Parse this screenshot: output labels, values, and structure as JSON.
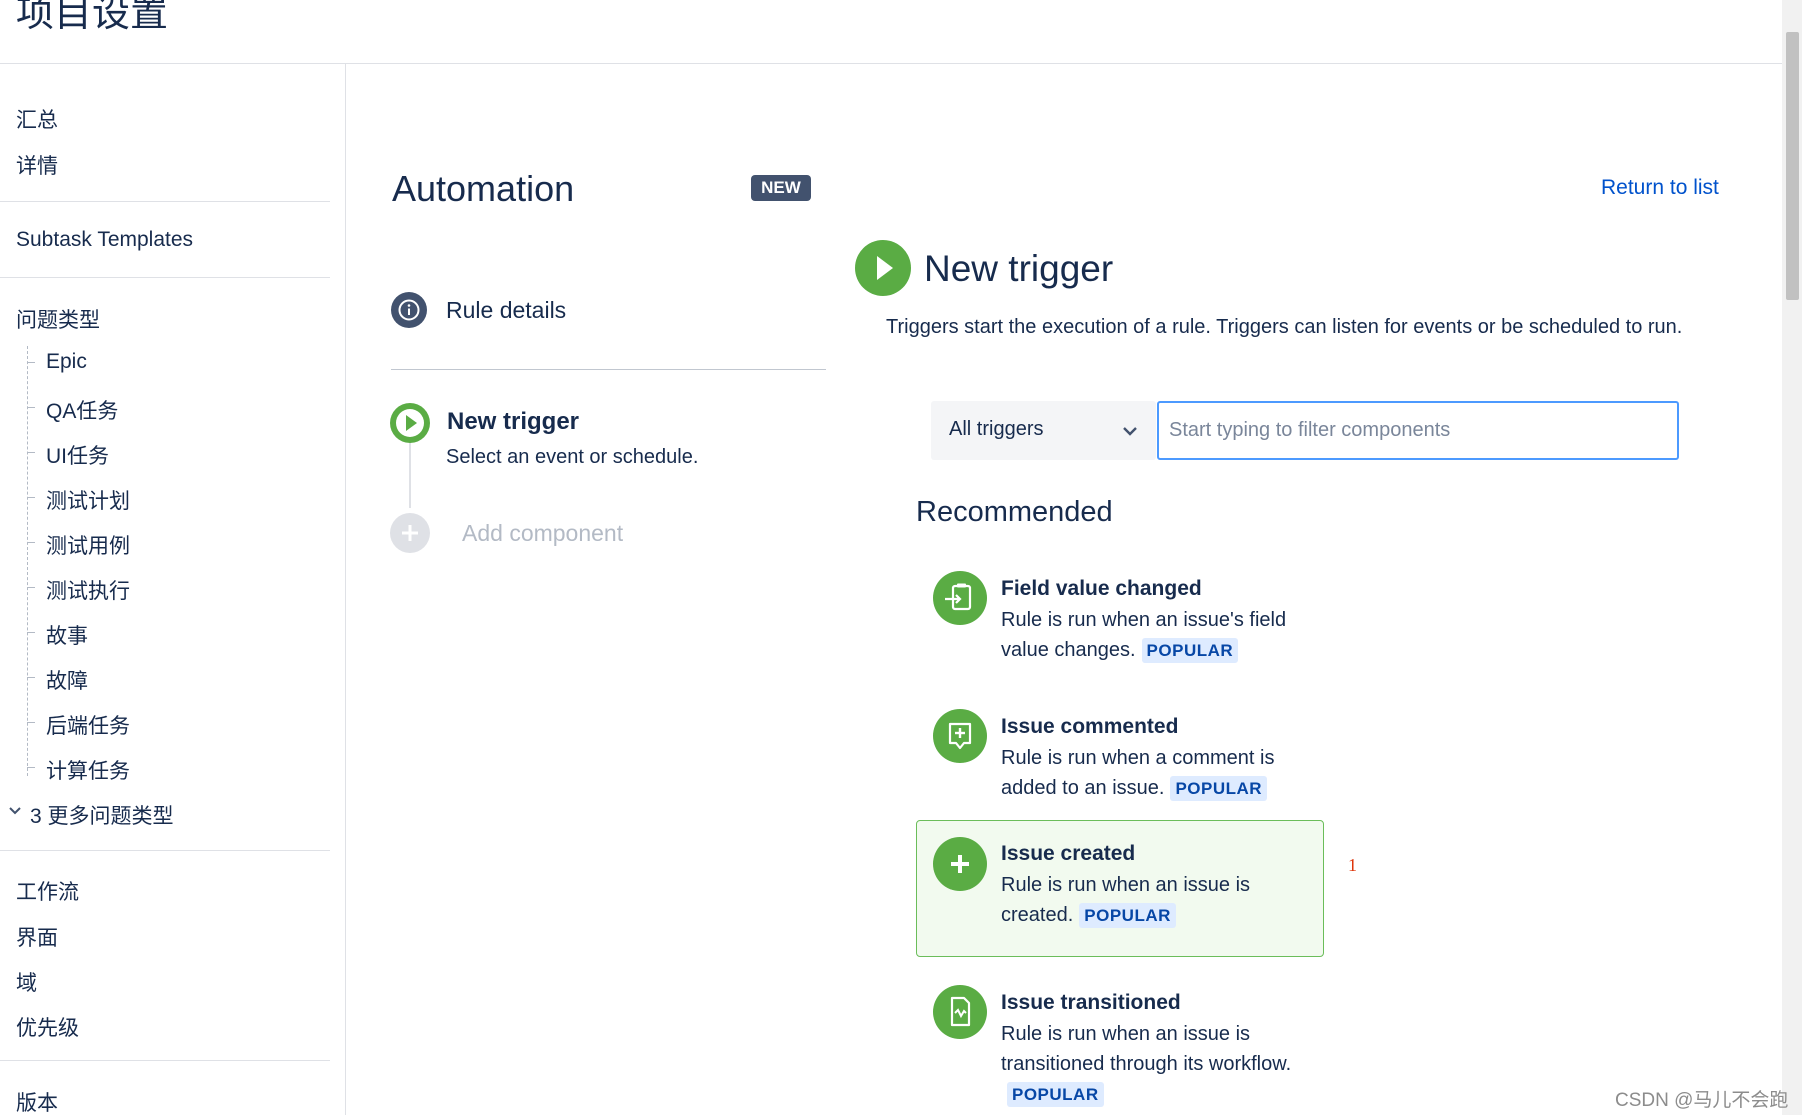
{
  "header": {
    "title": "项目设置"
  },
  "sidebar": {
    "top_items": [
      "汇总",
      "详情"
    ],
    "subtask_templates": "Subtask Templates",
    "issue_types_label": "问题类型",
    "issue_types": [
      "Epic",
      "QA任务",
      "UI任务",
      "测试计划",
      "测试用例",
      "测试执行",
      "故事",
      "故障",
      "后端任务",
      "计算任务"
    ],
    "more_types": "3 更多问题类型",
    "bottom_items": [
      "工作流",
      "界面",
      "域",
      "优先级"
    ],
    "versions": "版本"
  },
  "builder": {
    "title": "Automation",
    "badge": "NEW",
    "rule_details": "Rule details",
    "trigger_step_title": "New trigger",
    "trigger_step_desc": "Select an event or schedule.",
    "add_component": "Add component"
  },
  "panel": {
    "return_link": "Return to list",
    "title": "New trigger",
    "description": "Triggers start the execution of a rule. Triggers can listen for events or be scheduled to run.",
    "select_value": "All triggers",
    "filter_placeholder": "Start typing to filter components",
    "recommended": "Recommended",
    "cards": [
      {
        "title": "Field value changed",
        "desc": "Rule is run when an issue's field value changes.",
        "badge": "POPULAR",
        "icon": "field-change-icon"
      },
      {
        "title": "Issue commented",
        "desc": "Rule is run when a comment is added to an issue.",
        "badge": "POPULAR",
        "icon": "comment-add-icon"
      },
      {
        "title": "Issue created",
        "desc": "Rule is run when an issue is created.",
        "badge": "POPULAR",
        "icon": "plus-icon"
      },
      {
        "title": "Issue transitioned",
        "desc": "Rule is run when an issue is transitioned through its workflow.",
        "badge": "POPULAR",
        "icon": "transition-icon"
      }
    ],
    "annotation": "1"
  },
  "watermark": "CSDN @马儿不会跑",
  "colors": {
    "accent": "#0052cc",
    "trigger_green": "#5aac44",
    "badge_bg": "#42526e",
    "popular_bg": "#deebff",
    "selected_bg": "#f2faef"
  }
}
